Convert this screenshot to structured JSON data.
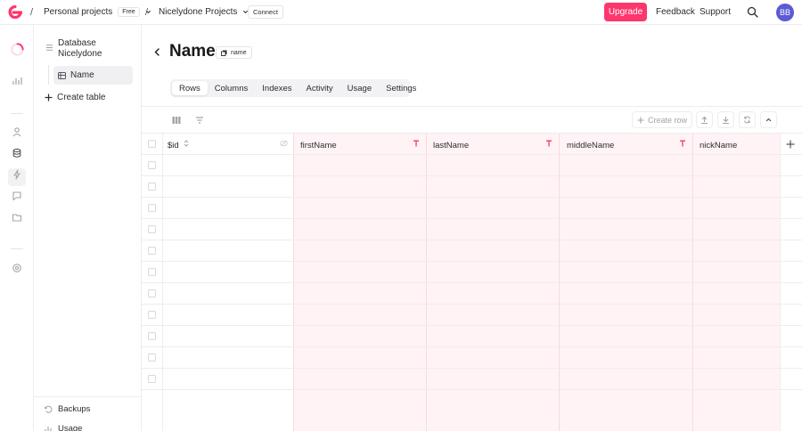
{
  "topbar": {
    "org_name": "Personal projects",
    "plan_badge": "Free",
    "project_name": "Nicelydone Projects",
    "connect_label": "Connect",
    "upgrade_label": "Upgrade",
    "feedback_label": "Feedback",
    "support_label": "Support",
    "avatar_initials": "BB",
    "accent_color": "#fd366e"
  },
  "sidebar": {
    "database_name": "Database Nicelydone",
    "table_name": "Name",
    "create_table_label": "Create table",
    "backups_label": "Backups",
    "usage_label": "Usage"
  },
  "header": {
    "title": "Name",
    "table_id": "name"
  },
  "tabs": [
    {
      "label": "Rows",
      "active": true
    },
    {
      "label": "Columns",
      "active": false
    },
    {
      "label": "Indexes",
      "active": false
    },
    {
      "label": "Activity",
      "active": false
    },
    {
      "label": "Usage",
      "active": false
    },
    {
      "label": "Settings",
      "active": false
    }
  ],
  "toolbar": {
    "create_row_label": "Create row"
  },
  "grid": {
    "columns": [
      {
        "label": "$id",
        "type_icon": "sort-icon"
      },
      {
        "label": "firstName",
        "type_icon": "text-type-icon"
      },
      {
        "label": "lastName",
        "type_icon": "text-type-icon"
      },
      {
        "label": "middleName",
        "type_icon": "text-type-icon"
      },
      {
        "label": "nickName",
        "type_icon": "text-type-icon"
      }
    ],
    "empty_rows": 11
  }
}
